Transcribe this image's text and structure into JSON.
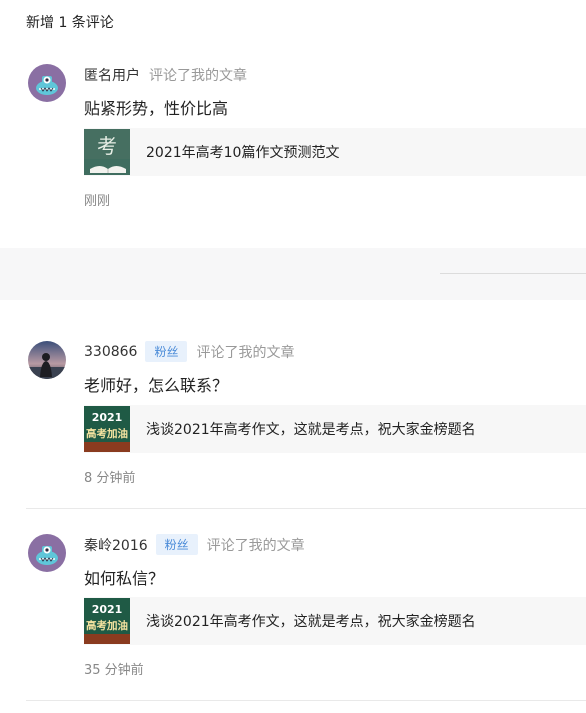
{
  "header": {
    "title": "新增 1 条评论"
  },
  "comments": [
    {
      "user": "匿名用户",
      "badge": "",
      "action": "评论了我的文章",
      "text": "贴紧形势，性价比高",
      "article_title": "2021年高考10篇作文预测范文",
      "time": "刚刚"
    },
    {
      "user": "330866",
      "badge": "粉丝",
      "action": "评论了我的文章",
      "text": "老师好，怎么联系？",
      "article_title": "浅谈2021年高考作文，这就是考点，祝大家金榜题名",
      "time": "8 分钟前"
    },
    {
      "user": "秦岭2016",
      "badge": "粉丝",
      "action": "评论了我的文章",
      "text": "如何私信？",
      "article_title": "浅谈2021年高考作文，这就是考点，祝大家金榜题名",
      "time": "35 分钟前"
    }
  ],
  "thumbs": {
    "kao_char": "考",
    "year": "2021",
    "slogan": "高考加油"
  },
  "colors": {
    "badge_bg": "#e8f1fc",
    "badge_text": "#4a8bd8",
    "avatar_bg": "#8a6fa3"
  }
}
